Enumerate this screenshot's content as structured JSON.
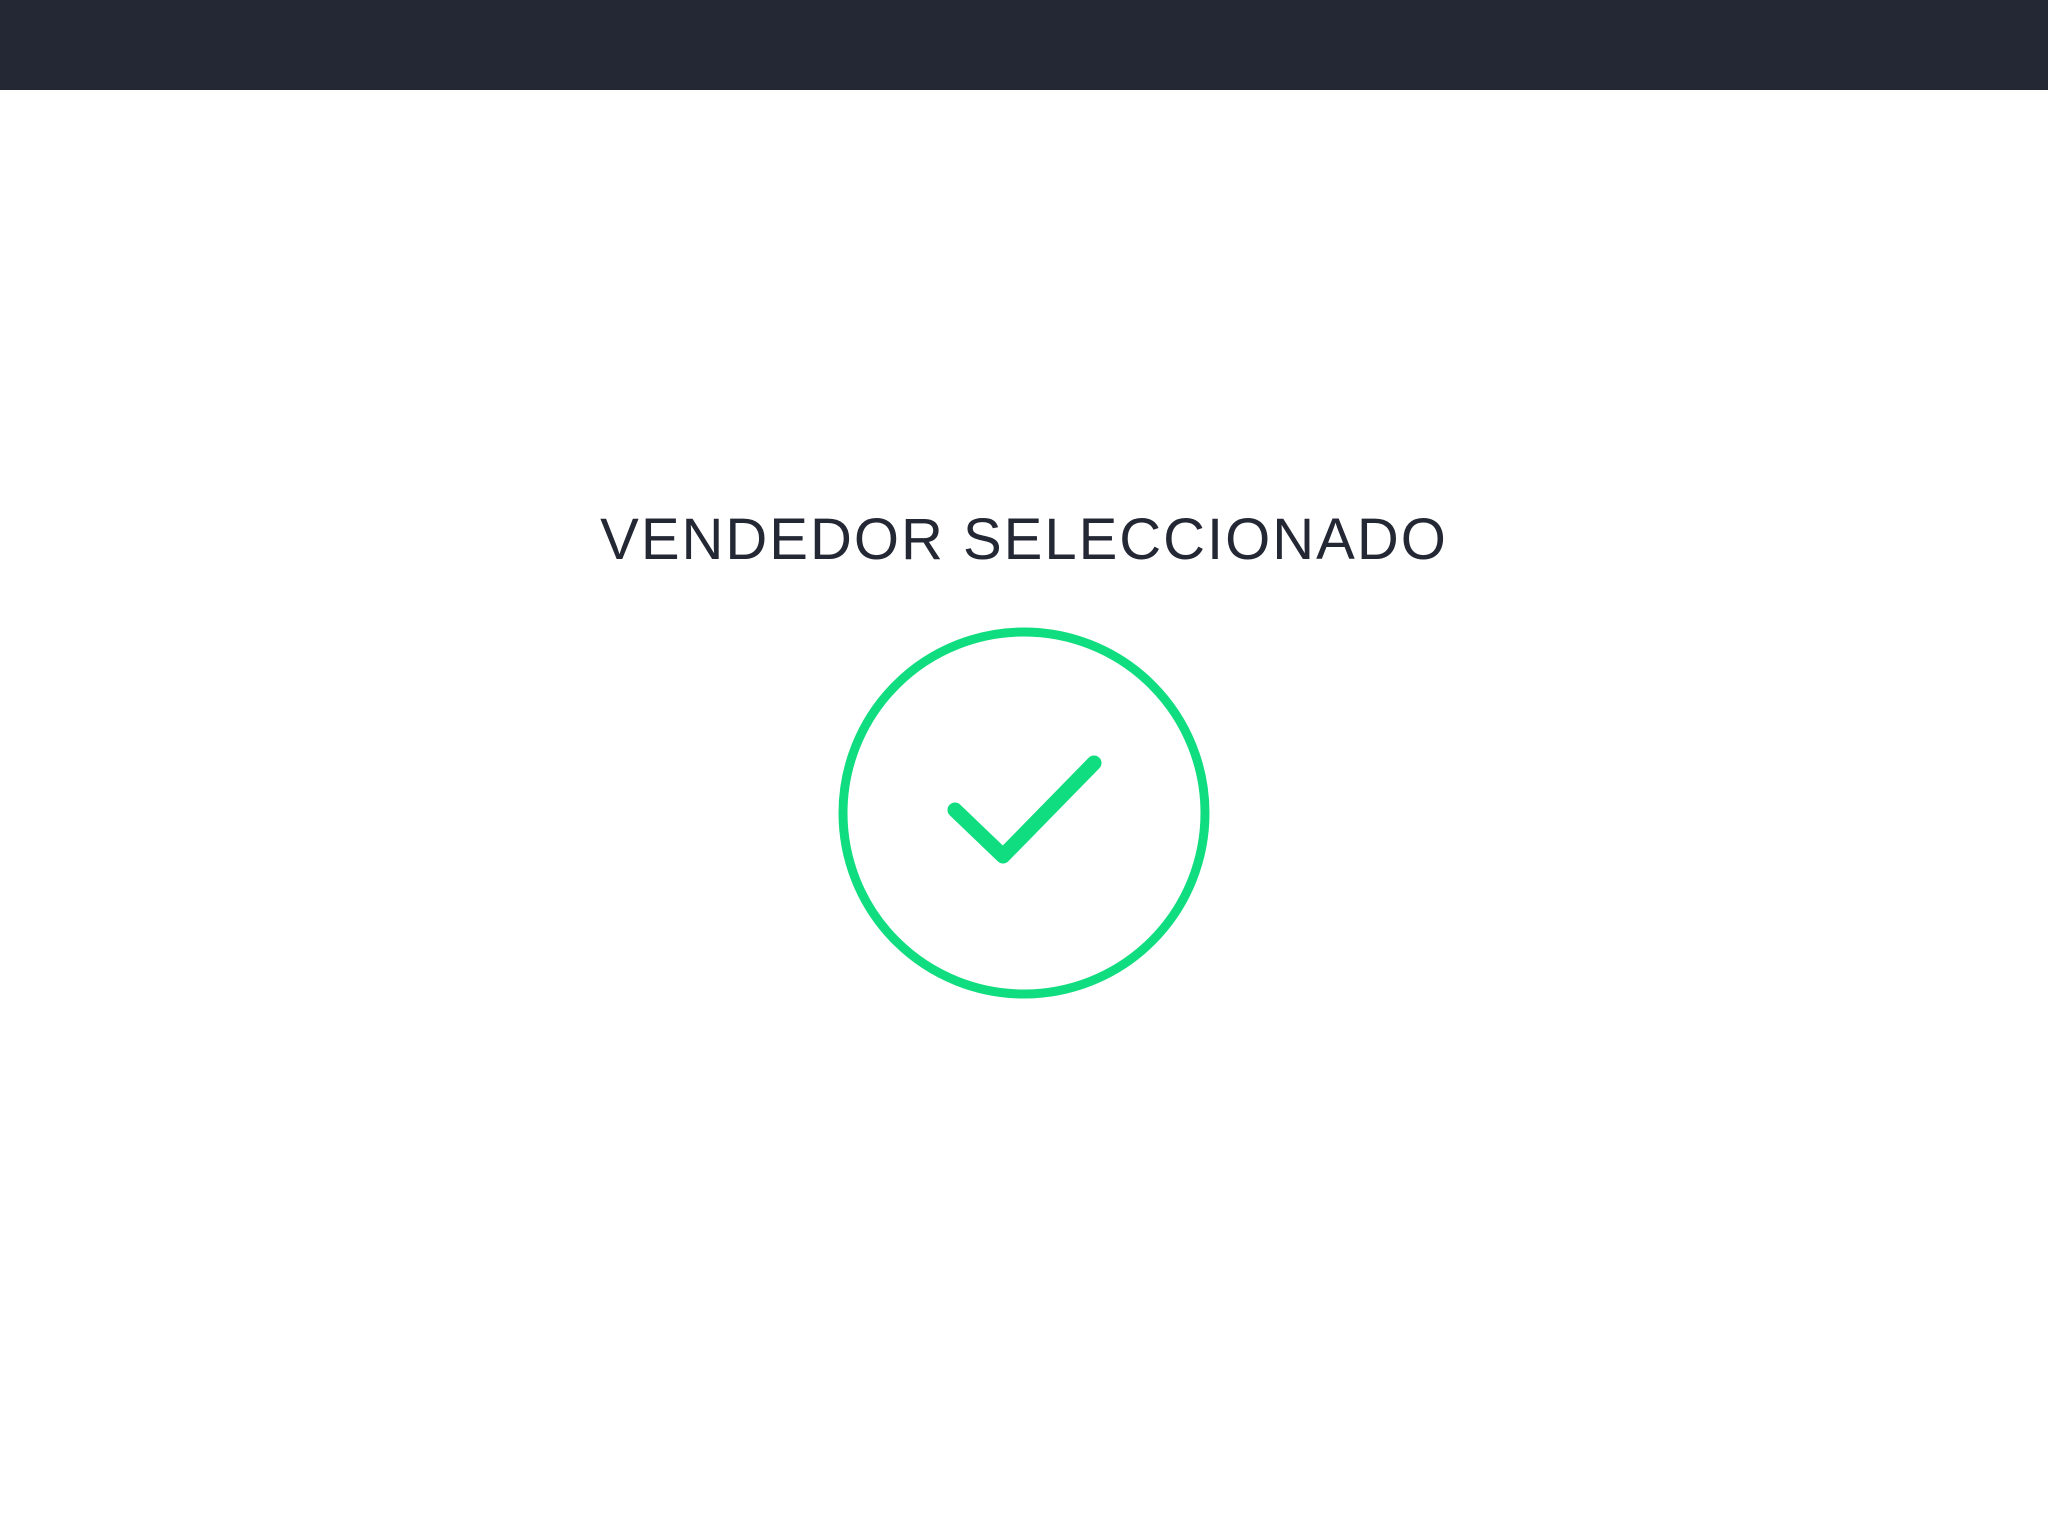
{
  "header": {
    "background_color": "#242834"
  },
  "confirmation": {
    "title": "VENDEDOR SELECCIONADO",
    "title_color": "#242834",
    "icon": "check-circle-icon",
    "accent_color": "#10DD7F"
  }
}
